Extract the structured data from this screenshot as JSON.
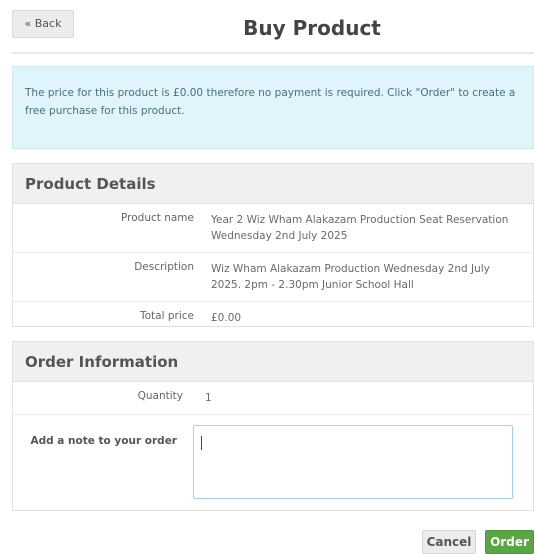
{
  "header": {
    "back_label": "« Back",
    "title": "Buy Product"
  },
  "info": {
    "message": "The price for this product is £0.00 therefore no payment is required. Click \"Order\" to create a free purchase for this product."
  },
  "product_details": {
    "heading": "Product Details",
    "rows": [
      {
        "label": "Product name",
        "value": "Year 2 Wiz Wham Alakazam Production Seat Reservation Wednesday 2nd July 2025"
      },
      {
        "label": "Description",
        "value": "Wiz Wham Alakazam Production Wednesday 2nd July 2025. 2pm - 2.30pm Junior School Hall"
      },
      {
        "label": "Total price",
        "value": "£0.00"
      }
    ]
  },
  "order_information": {
    "heading": "Order Information",
    "quantity_label": "Quantity",
    "quantity_value": "1",
    "note_label": "Add a note to your order",
    "note_value": ""
  },
  "actions": {
    "cancel_label": "Cancel",
    "order_label": "Order"
  },
  "colors": {
    "info_bg": "#dff4fb",
    "order_button": "#5aa642"
  }
}
